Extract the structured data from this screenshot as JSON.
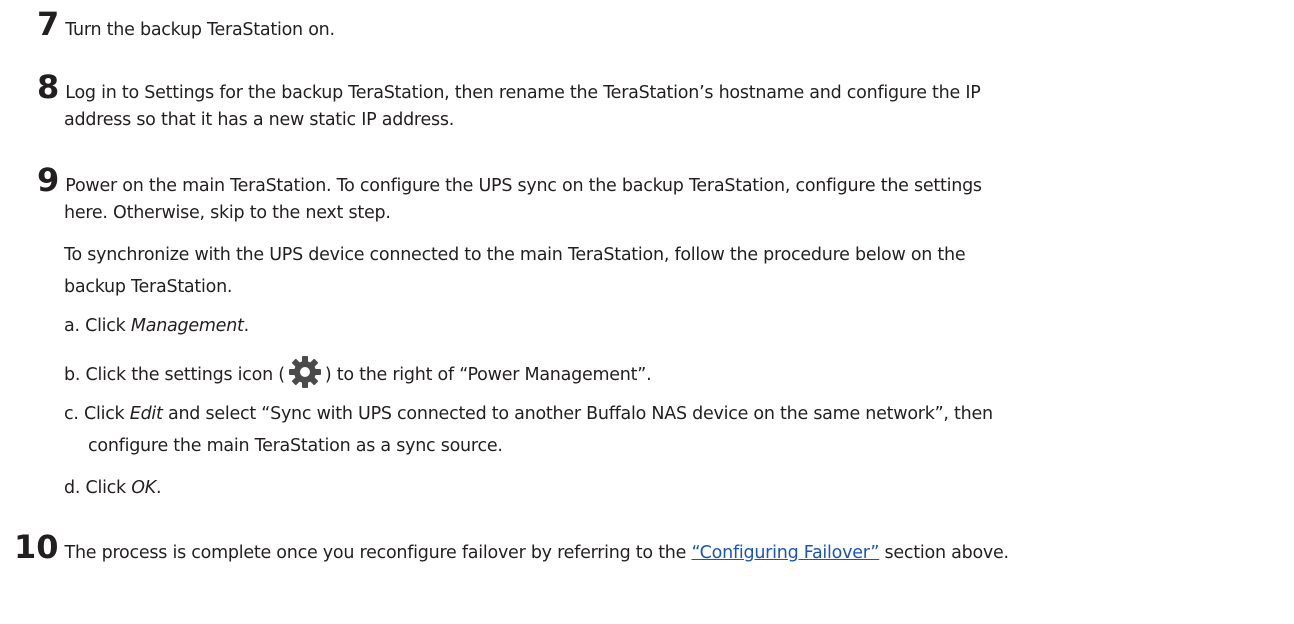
{
  "steps": [
    {
      "num": "7",
      "text": "Turn the backup TeraStation on."
    },
    {
      "num": "8",
      "line1": "Log in to Settings for the backup TeraStation, then rename the TeraStation’s hostname and configure the IP",
      "line2": "address so that it has a new static IP address."
    },
    {
      "num": "9",
      "line1": "Power on the main TeraStation. To configure the UPS sync on the backup TeraStation, configure the settings",
      "line2": "here. Otherwise, skip to the next step.",
      "para_line1": "To synchronize with the UPS device connected to the main TeraStation, follow the procedure below on the",
      "para_line2": "backup TeraStation.",
      "substeps": {
        "a_prefix": "a. Click ",
        "a_em": "Management",
        "a_suffix": ".",
        "b_prefix": "b. Click the settings icon (",
        "b_suffix": ") to the right of “Power Management”.",
        "c_prefix": "c. Click ",
        "c_em": "Edit",
        "c_line1_rest": " and select “Sync with UPS connected to another Buffalo NAS device on the same network”, then",
        "c_line2": "configure the main TeraStation as a sync source.",
        "d_prefix": "d. Click ",
        "d_em": "OK",
        "d_suffix": "."
      }
    },
    {
      "num": "10",
      "text_before": "The process is complete once you reconfigure failover by referring to the ",
      "link": "“Configuring Failover”",
      "text_after": " section above."
    }
  ],
  "icons": {
    "settings": "gear-icon"
  },
  "colors": {
    "text": "#231f20",
    "link": "#1a56b4",
    "icon": "#4a4a4a"
  }
}
